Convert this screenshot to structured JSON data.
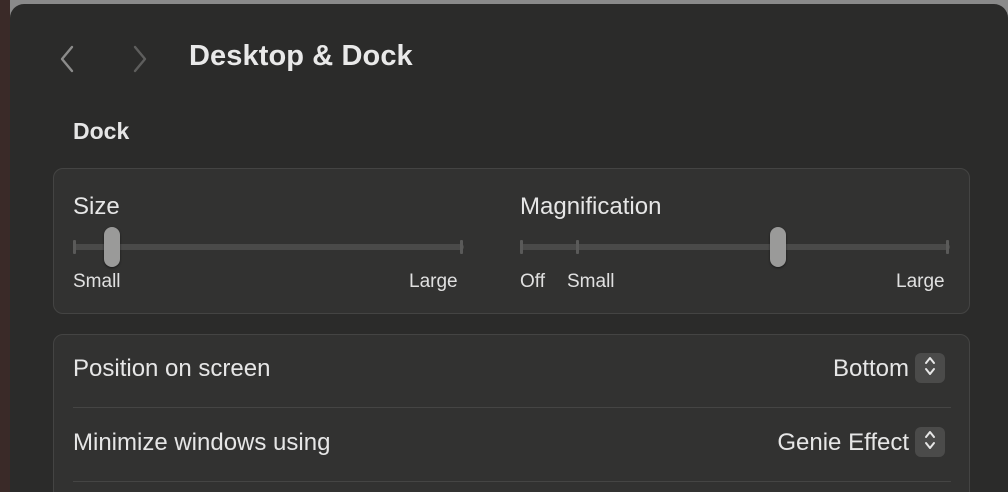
{
  "header": {
    "title": "Desktop & Dock",
    "back_icon": "chevron-left-icon",
    "forward_icon": "chevron-right-icon"
  },
  "dock_section": {
    "title": "Dock",
    "size_slider": {
      "label": "Size",
      "min_label": "Small",
      "max_label": "Large",
      "value_fraction": 0.1
    },
    "magnification_slider": {
      "label": "Magnification",
      "off_label": "Off",
      "min_label": "Small",
      "max_label": "Large",
      "value_fraction": 0.6
    }
  },
  "settings_rows": [
    {
      "label": "Position on screen",
      "value": "Bottom"
    },
    {
      "label": "Minimize windows using",
      "value": "Genie Effect"
    }
  ],
  "colors": {
    "window_bg": "#2b2b2a",
    "group_bg": "#323231",
    "thumb": "#9a9a99"
  }
}
